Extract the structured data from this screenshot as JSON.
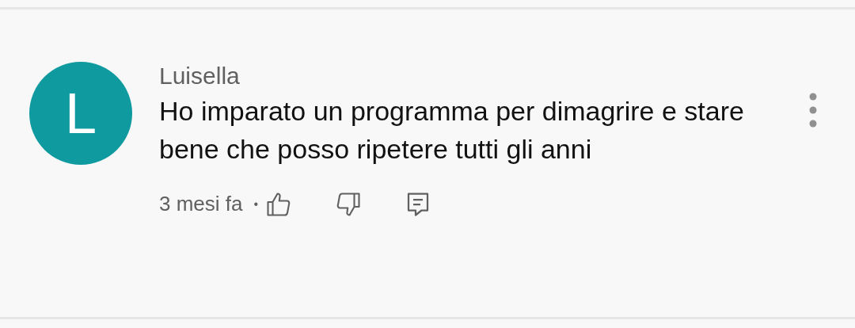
{
  "comment": {
    "avatar": {
      "letter": "L",
      "color": "#0f9aa0"
    },
    "author": "Luisella",
    "text": "Ho imparato un programma per dimagrire e stare bene che posso ripetere tutti gli anni",
    "time": "3 mesi fa",
    "separator": "•"
  }
}
